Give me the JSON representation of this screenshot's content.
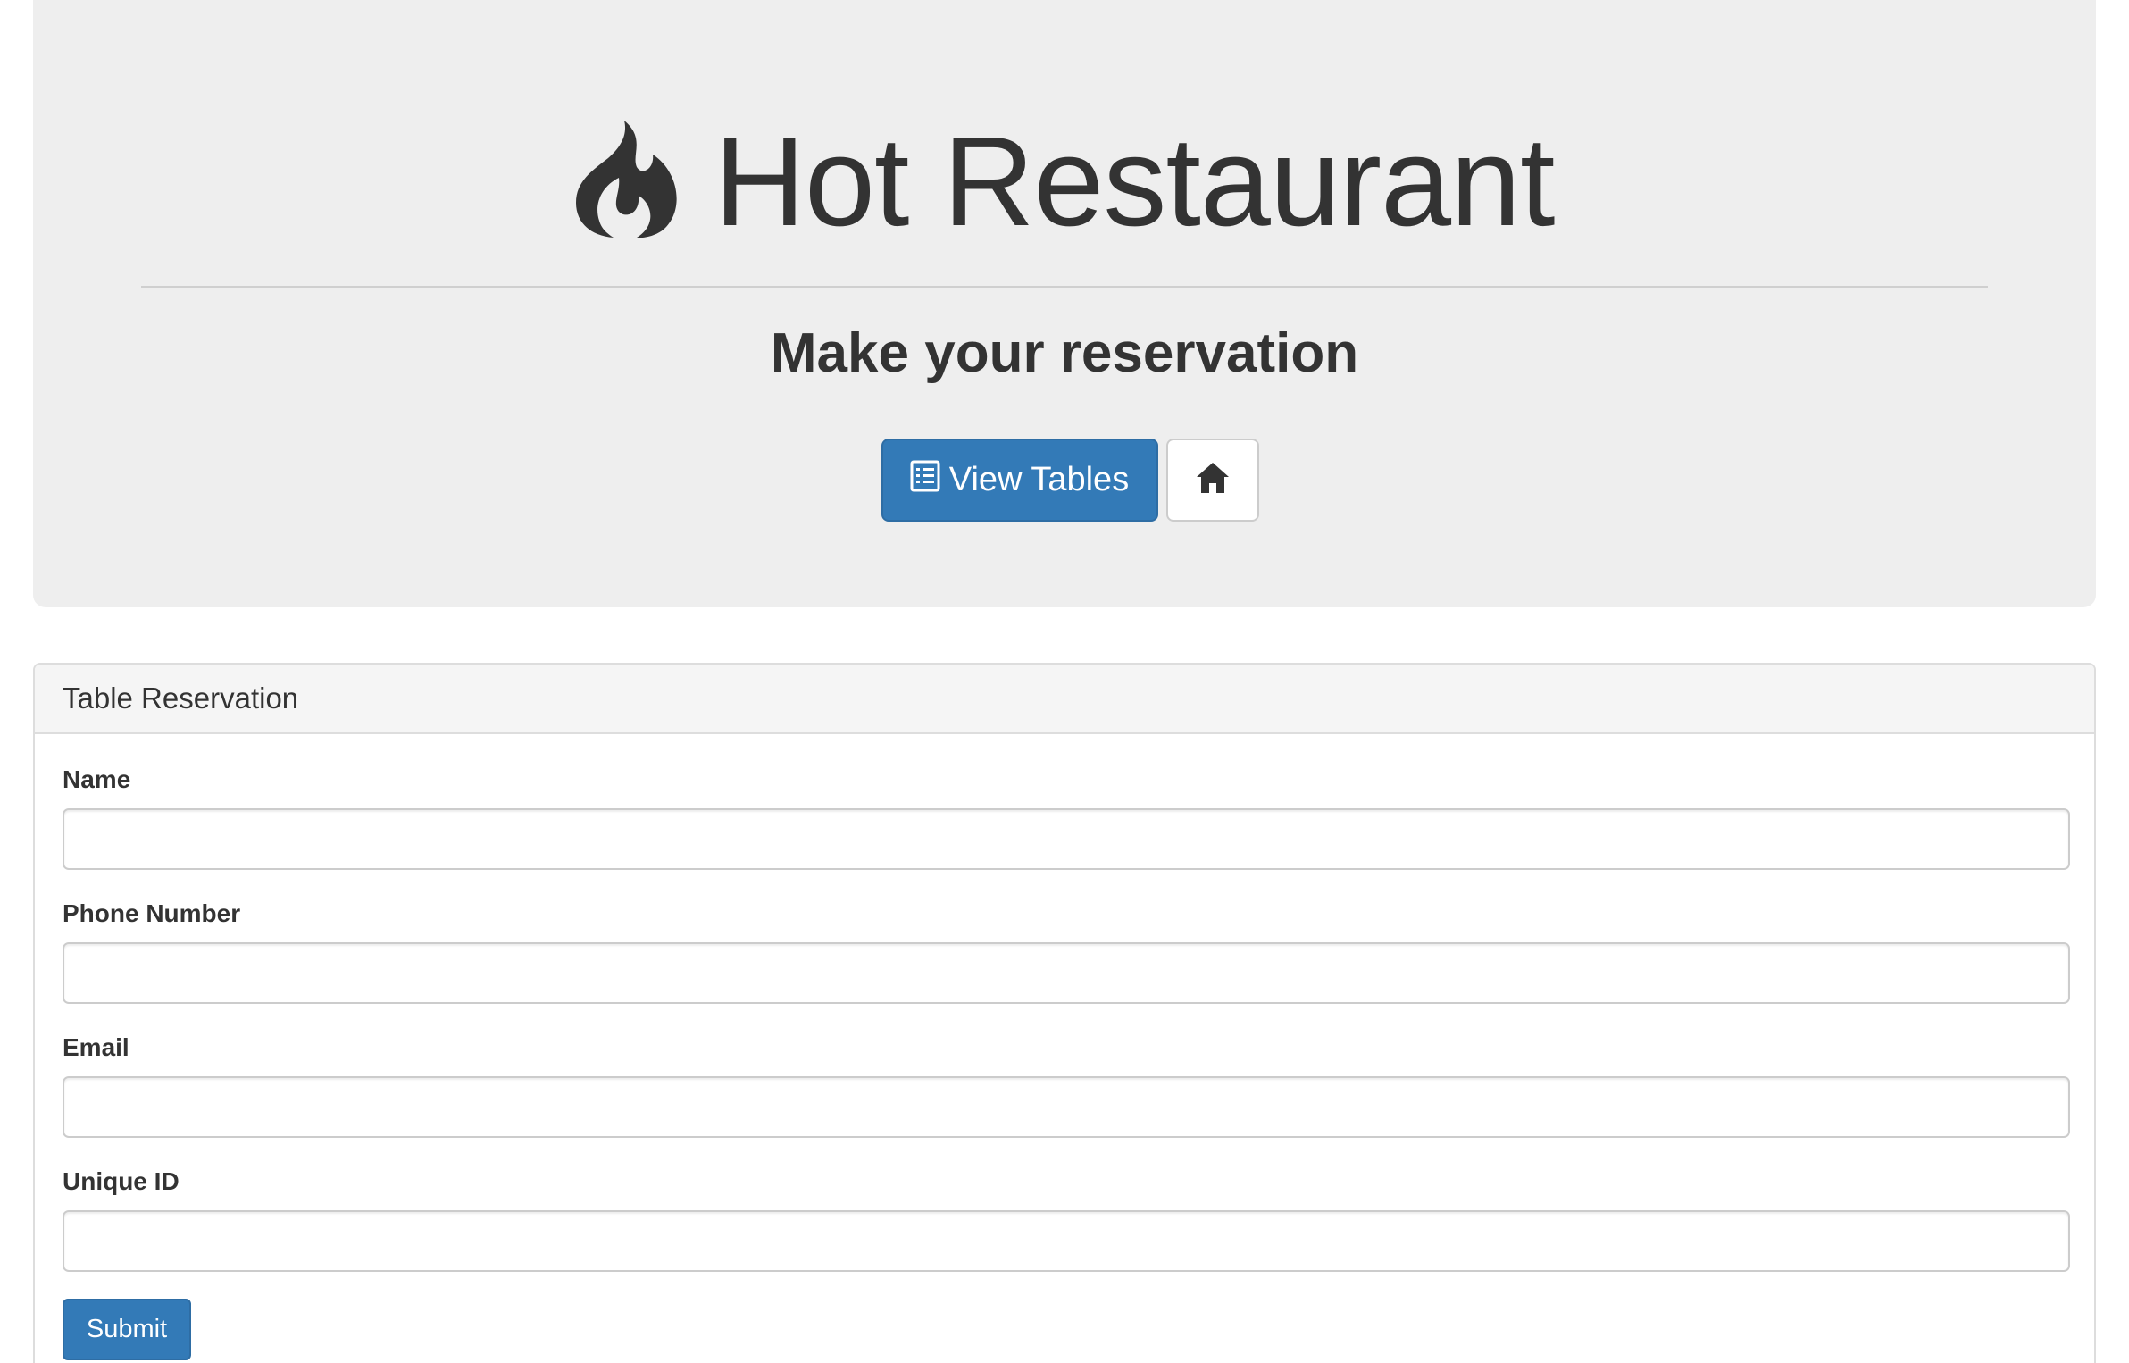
{
  "header": {
    "title": "Hot Restaurant",
    "brand_icon": "flame-icon",
    "subtitle": "Make your reservation",
    "view_tables_label": "View Tables",
    "view_tables_icon": "list-alt-icon",
    "home_icon": "home-icon"
  },
  "panel": {
    "heading": "Table Reservation",
    "fields": [
      {
        "label": "Name",
        "value": "",
        "placeholder": ""
      },
      {
        "label": "Phone Number",
        "value": "",
        "placeholder": ""
      },
      {
        "label": "Email",
        "value": "",
        "placeholder": ""
      },
      {
        "label": "Unique ID",
        "value": "",
        "placeholder": ""
      }
    ],
    "submit_label": "Submit"
  },
  "colors": {
    "primary": "#337ab7",
    "jumbotron_bg": "#eeeeee",
    "text": "#333333"
  }
}
